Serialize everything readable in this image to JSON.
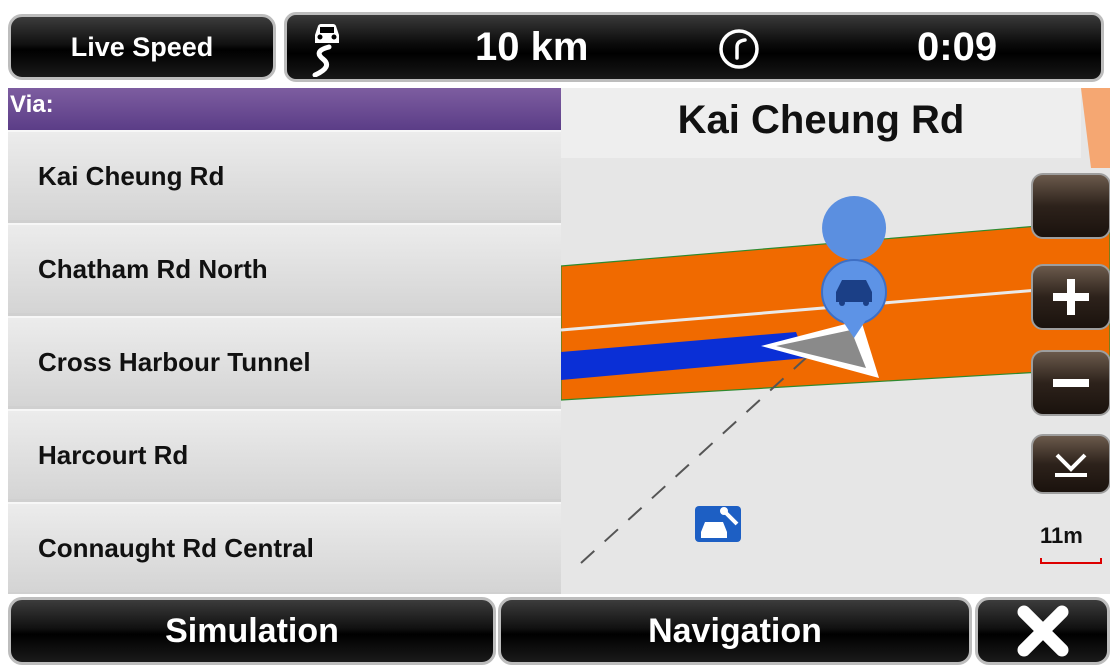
{
  "top_bar": {
    "live_speed_label": "Live Speed",
    "distance": "10 km",
    "time": "0:09"
  },
  "route_panel": {
    "header": "Via:",
    "items": [
      "Kai Cheung Rd",
      "Chatham Rd North",
      "Cross Harbour Tunnel",
      "Harcourt Rd",
      "Connaught Rd Central"
    ]
  },
  "map": {
    "current_street": "Kai Cheung Rd",
    "scale_label": "11m",
    "road_color": "#f06a00",
    "route_color": "#0a2fd6",
    "poi_icon": "car-repair-icon",
    "vehicle_icon": "car-marker-icon"
  },
  "bottom_bar": {
    "simulation_label": "Simulation",
    "navigation_label": "Navigation",
    "close_icon": "close-icon"
  }
}
